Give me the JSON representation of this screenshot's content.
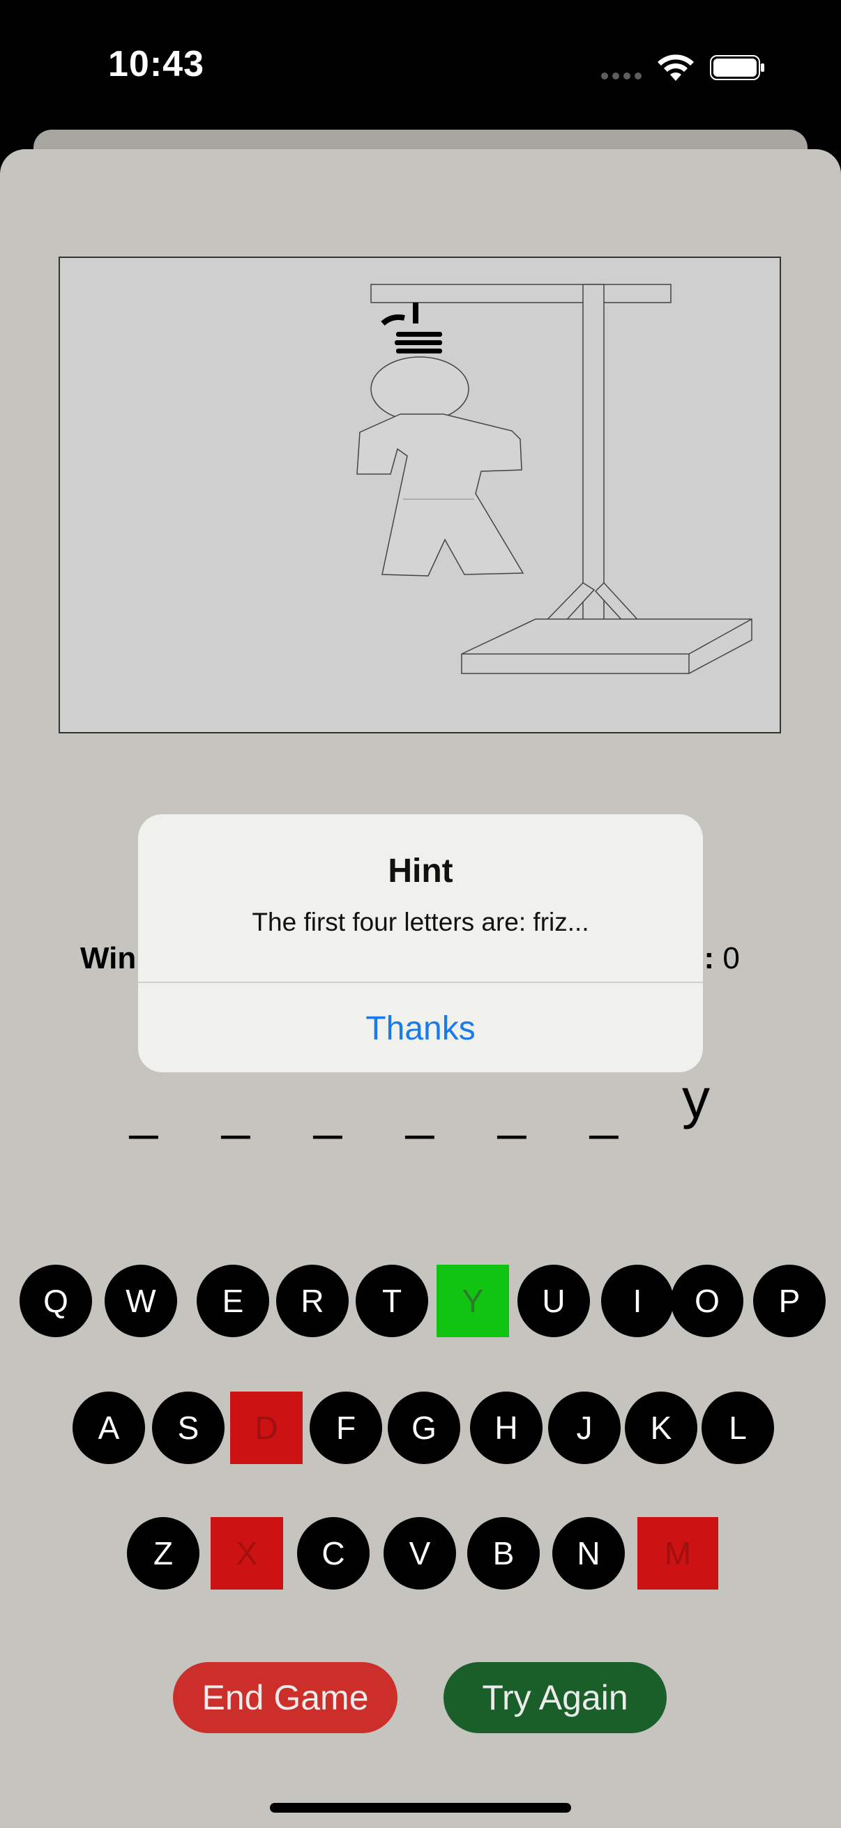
{
  "status_bar": {
    "time": "10:43"
  },
  "stats": {
    "left_label_partial": "Win",
    "right_label_partial": "s:",
    "right_value": "0"
  },
  "word": {
    "slots": [
      "_",
      "_",
      "_",
      "_",
      "_",
      "_"
    ],
    "revealed_letter": "y"
  },
  "keyboard": {
    "rows": [
      [
        "Q",
        "W",
        "E",
        "R",
        "T",
        "Y",
        "U",
        "I",
        "O",
        "P"
      ],
      [
        "A",
        "S",
        "D",
        "F",
        "G",
        "H",
        "J",
        "K",
        "L"
      ],
      [
        "Z",
        "X",
        "C",
        "V",
        "B",
        "N",
        "M"
      ]
    ],
    "correct": [
      "Y"
    ],
    "incorrect": [
      "D",
      "X",
      "M"
    ]
  },
  "buttons": {
    "end_game": "End Game",
    "try_again": "Try Again"
  },
  "alert": {
    "title": "Hint",
    "message": "The first four letters are: friz...",
    "action": "Thanks"
  },
  "colors": {
    "correct": "#11c411",
    "incorrect": "#cc1212",
    "end_game": "#cc2e2a",
    "try_again": "#1a5e2a",
    "alert_action": "#1a7ae8"
  }
}
